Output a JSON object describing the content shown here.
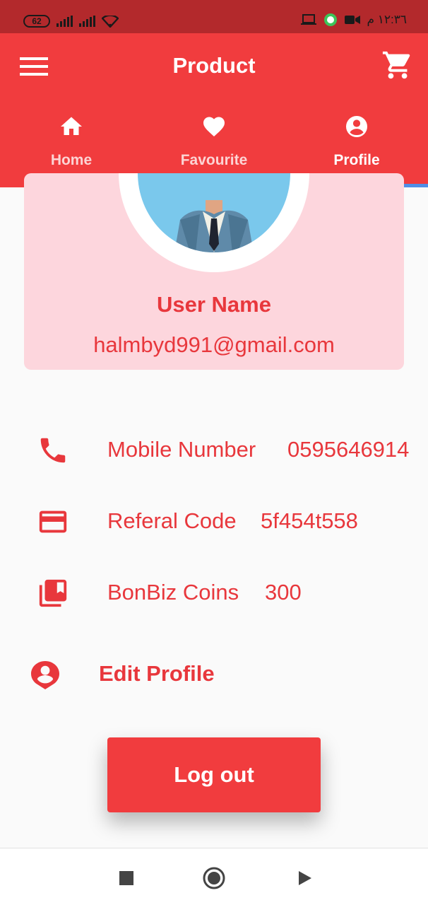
{
  "status_bar": {
    "battery": "62",
    "time": "١٢:٣٦ م"
  },
  "app_bar": {
    "title": "Product",
    "menu_icon": "hamburger-menu-icon",
    "cart_icon": "shopping-cart-icon"
  },
  "tabs": [
    {
      "label": "Home",
      "icon": "home-icon",
      "active": false
    },
    {
      "label": "Favourite",
      "icon": "heart-icon",
      "active": false
    },
    {
      "label": "Profile",
      "icon": "account-circle-icon",
      "active": true
    }
  ],
  "profile": {
    "user_name": "User Name",
    "email": "halmbyd991@gmail.com"
  },
  "info": {
    "mobile_label": "Mobile Number",
    "mobile_value": "0595646914",
    "referral_label": "Referal Code",
    "referral_value": "5f454t558",
    "coins_label": "BonBiz Coins",
    "coins_value": "300"
  },
  "edit_profile": {
    "label": "Edit Profile"
  },
  "logout": {
    "label": "Log out"
  },
  "colors": {
    "primary": "#f13c3e",
    "status_bar": "#b3292c",
    "card_bg": "#fdd6dd",
    "text_accent": "#e8373c",
    "tab_indicator": "#4f8ee6"
  }
}
